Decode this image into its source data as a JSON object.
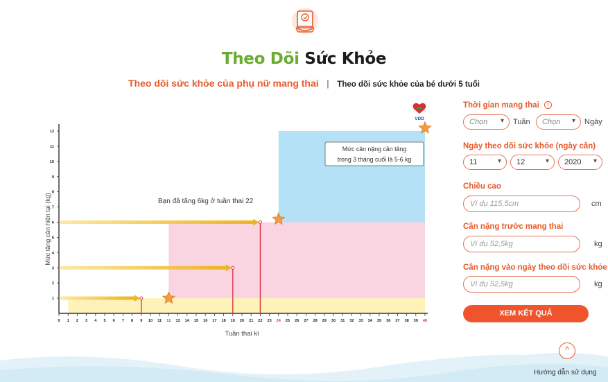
{
  "header": {
    "title_part1": "Theo Dõi",
    "title_part2": "Sức Khỏe",
    "icon": "document-icon"
  },
  "tabs": [
    {
      "label": "Theo dõi sức khỏe của phụ nữ mang thai",
      "active": true
    },
    {
      "label": "Theo dõi sức khỏe của bé dưới 5 tuổi",
      "active": false
    }
  ],
  "chart_data": {
    "type": "line",
    "xlabel": "Tuần thai kì",
    "ylabel": "Mức tăng cân hiện tại (kg)",
    "xlim": [
      0,
      40
    ],
    "ylim": [
      0,
      12
    ],
    "x_ticks": [
      0,
      1,
      2,
      3,
      4,
      5,
      6,
      7,
      8,
      9,
      10,
      11,
      12,
      13,
      14,
      15,
      16,
      17,
      18,
      19,
      20,
      21,
      22,
      23,
      24,
      25,
      26,
      27,
      28,
      29,
      30,
      31,
      32,
      33,
      34,
      35,
      36,
      37,
      38,
      39,
      40
    ],
    "highlighted_ticks": [
      12,
      24,
      40
    ],
    "y_ticks": [
      1,
      2,
      3,
      4,
      5,
      6,
      7,
      8,
      9,
      10,
      11,
      12
    ],
    "zones": [
      {
        "x_from": 1,
        "x_to": 40,
        "y_from": 0,
        "y_to": 1,
        "color": "#fdf3b8"
      },
      {
        "x_from": 12,
        "x_to": 40,
        "y_from": 1,
        "y_to": 6,
        "color": "#f9d5e2"
      },
      {
        "x_from": 24,
        "x_to": 40,
        "y_from": 6,
        "y_to": 12,
        "color": "#b5e1f6"
      }
    ],
    "milestones": [
      {
        "x": 9,
        "y": 1
      },
      {
        "x": 19,
        "y": 3
      },
      {
        "x": 22,
        "y": 6
      }
    ],
    "stars": [
      {
        "x": 12,
        "y": 1
      },
      {
        "x": 24,
        "y": 6.2
      },
      {
        "x": 40,
        "y": 12.2
      }
    ],
    "annotations": {
      "progress": "Bạn đã tăng 6kg ở tuần thai 22",
      "callout_line1": "Mức cân nặng cần tăng",
      "callout_line2": "trong 3 tháng cuối là 5-6 kg"
    },
    "logo_text": "VDD"
  },
  "form": {
    "pregnancy_time": {
      "label": "Thời gian mang thai",
      "week_placeholder": "Chọn",
      "week_unit": "Tuần",
      "day_placeholder": "Chọn",
      "day_unit": "Ngày"
    },
    "tracking_date": {
      "label": "Ngày theo dõi sức khỏe (ngày cân)",
      "day": "11",
      "month": "12",
      "year": "2020"
    },
    "height": {
      "label": "Chiều cao",
      "placeholder": "Ví dụ 115,5cm",
      "unit": "cm"
    },
    "weight_before": {
      "label": "Cân nặng trước mang thai",
      "placeholder": "Ví dụ 52,5kg",
      "unit": "kg"
    },
    "weight_now": {
      "label": "Cân nặng vào ngày theo dõi sức khỏe",
      "placeholder": "Ví dụ 52,5kg",
      "unit": "kg"
    },
    "submit_label": "XEM KẾT QUẢ"
  },
  "help": {
    "label": "Hướng dẫn sử dụng",
    "icon": "chevron-up-icon"
  },
  "colors": {
    "accent": "#f0542d",
    "green": "#6aac2f",
    "arrow_gold": "#eeb321",
    "marker_red": "#e0334a"
  }
}
